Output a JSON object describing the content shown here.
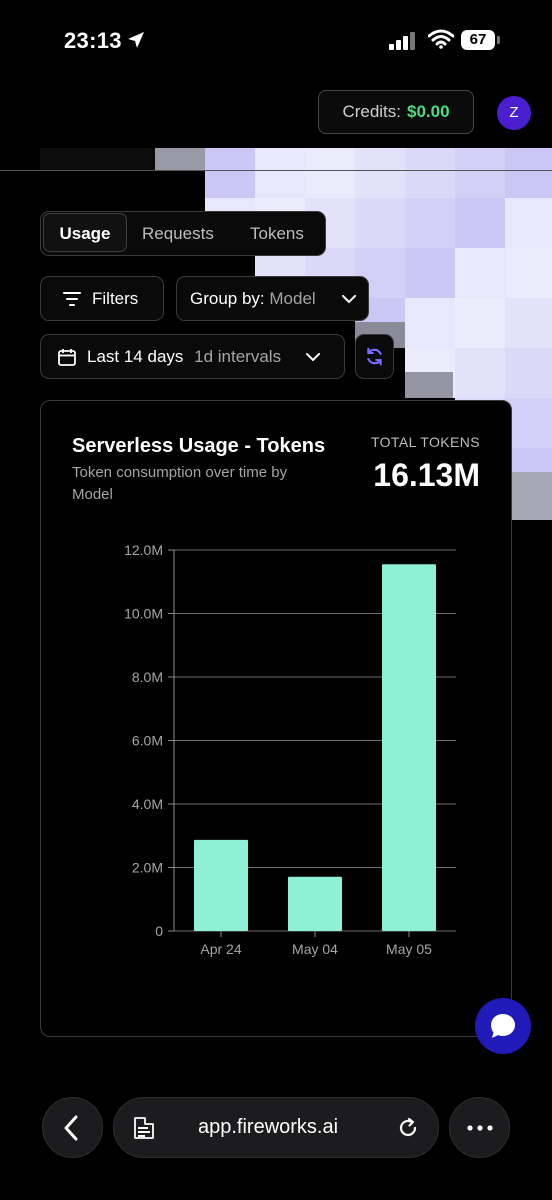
{
  "status_bar": {
    "time": "23:13",
    "battery": "67"
  },
  "header": {
    "credits_label": "Credits:",
    "credits_value": "$0.00",
    "avatar_initial": "Z"
  },
  "tabs": [
    {
      "label": "Usage",
      "active": true
    },
    {
      "label": "Requests",
      "active": false
    },
    {
      "label": "Tokens",
      "active": false
    }
  ],
  "filters": {
    "filters_label": "Filters",
    "group_by_label": "Group by:",
    "group_by_value": "Model"
  },
  "date_range": {
    "range_label": "Last 14 days",
    "interval_label": "1d intervals"
  },
  "card": {
    "title": "Serverless Usage - Tokens",
    "subtitle": "Token consumption over time by Model",
    "total_label": "TOTAL TOKENS",
    "total_value": "16.13M"
  },
  "chart_data": {
    "type": "bar",
    "categories": [
      "Apr 24",
      "May 04",
      "May 05"
    ],
    "values": [
      2.87,
      1.71,
      11.55
    ],
    "units": "M",
    "ylim": [
      0,
      12
    ],
    "yticks": [
      "0",
      "2.0M",
      "4.0M",
      "6.0M",
      "8.0M",
      "10.0M",
      "12.0M"
    ],
    "grid": true,
    "bar_color": "#8ff0d8"
  },
  "browser": {
    "url": "app.fireworks.ai"
  },
  "colors": {
    "accent": "#4b1fd0",
    "credits_value": "#4ade80",
    "chat_bubble": "#1f1ab8"
  }
}
